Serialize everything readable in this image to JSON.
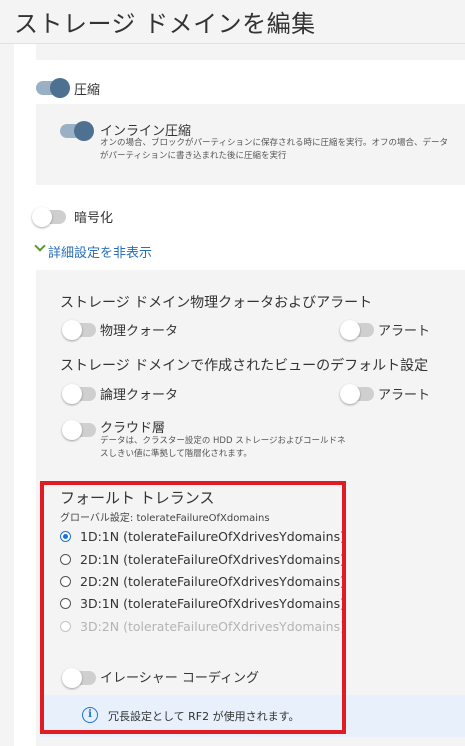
{
  "header": {
    "title": "ストレージ ドメインを編集"
  },
  "compression": {
    "label": "圧縮",
    "enabled": true,
    "inline": {
      "label": "インライン圧縮",
      "enabled": true,
      "description": "オンの場合、ブロックがパーティションに保存される時に圧縮を実行。オフの場合、データがパーティションに書き込まれた後に圧縮を実行"
    }
  },
  "encryption": {
    "label": "暗号化",
    "enabled": false
  },
  "advanced_toggle": {
    "label": "詳細設定を非表示"
  },
  "physical_quota_section": {
    "title": "ストレージ ドメイン物理クォータおよびアラート",
    "quota_label": "物理クォータ",
    "alert_label": "アラート"
  },
  "view_defaults_section": {
    "title": "ストレージ ドメインで作成されたビューのデフォルト設定",
    "quota_label": "論理クォータ",
    "alert_label": "アラート"
  },
  "cloud_tier": {
    "label": "クラウド層",
    "enabled": false,
    "description": "データは、クラスター設定の HDD ストレージおよびコールドネスしきい値に準拠して階層化されます。"
  },
  "fault_tolerance": {
    "title": "フォールト トレランス",
    "global_setting": "グローバル設定: tolerateFailureOfXdomains",
    "options": [
      {
        "label": "1D:1N (tolerateFailureOfXdrivesYdomains)",
        "checked": true,
        "disabled": false
      },
      {
        "label": "2D:1N (tolerateFailureOfXdrivesYdomains)",
        "checked": false,
        "disabled": false
      },
      {
        "label": "2D:2N (tolerateFailureOfXdrivesYdomains)",
        "checked": false,
        "disabled": false
      },
      {
        "label": "3D:1N (tolerateFailureOfXdrivesYdomains)",
        "checked": false,
        "disabled": false
      },
      {
        "label": "3D:2N (tolerateFailureOfXdrivesYdomains)",
        "checked": false,
        "disabled": true
      }
    ]
  },
  "erasure_coding": {
    "label": "イレーシャー コーディング",
    "enabled": false
  },
  "info": {
    "message": "冗長設定として RF2 が使用されます。",
    "icon": "info-icon"
  },
  "colors": {
    "accent": "#1a73d9",
    "toggle_on": "#4e7191",
    "highlight": "#e01b24",
    "link": "#2a6ebb"
  }
}
